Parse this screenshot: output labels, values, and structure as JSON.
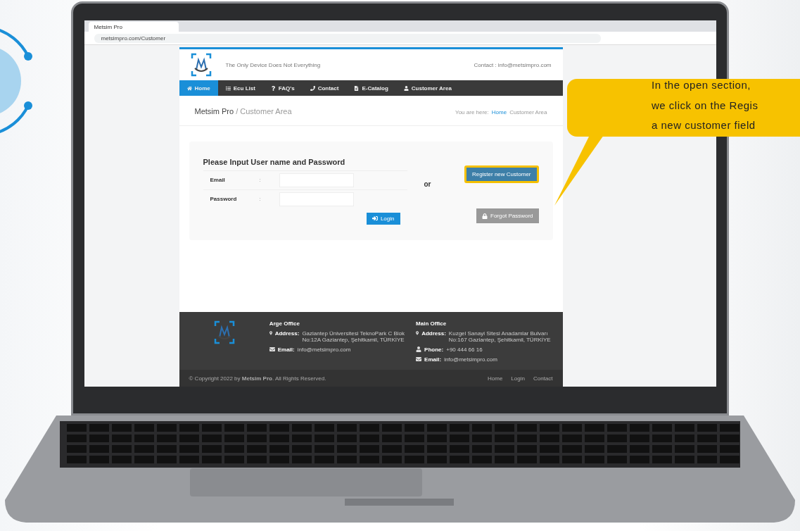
{
  "browser": {
    "tab_title": "Metsim Pro",
    "url": "metsimpro.com/Customer"
  },
  "site": {
    "tagline": "The Only Device Does Not Everything",
    "contact": "Contact : info@metsimpro.com",
    "nav": [
      {
        "label": "Home",
        "selected": true
      },
      {
        "label": "Ecu List",
        "selected": false
      },
      {
        "label": "FAQ's",
        "selected": false
      },
      {
        "label": "Contact",
        "selected": false
      },
      {
        "label": "E-Catalog",
        "selected": false
      },
      {
        "label": "Customer Area",
        "selected": false
      }
    ],
    "heading": {
      "brand": "Metsim Pro",
      "section": "/ Customer Area"
    },
    "breadcrumb": {
      "prefix": "You are here:",
      "home": "Home",
      "current": "Customer Area"
    },
    "login": {
      "title": "Please Input User name and Password",
      "fields": [
        {
          "label": "Email",
          "separator": ":"
        },
        {
          "label": "Password",
          "separator": ":"
        }
      ],
      "button": "Login"
    },
    "or_text": "or",
    "register": {
      "label": "Register new Customer",
      "highlighted": true
    },
    "forgot": {
      "label": "Forgot Password"
    },
    "footer": {
      "offices": [
        {
          "title": "Arge Office",
          "lines": [
            {
              "kind": "address",
              "label": "Address:",
              "value": "Gaziantep Üniversitesi TeknoPark C Blok No:12A Gaziantep, Şehitkamil, TÜRKİYE"
            },
            {
              "kind": "email",
              "label": "Email:",
              "value": "info@metsimpro.com"
            }
          ]
        },
        {
          "title": "Main Office",
          "lines": [
            {
              "kind": "address",
              "label": "Address:",
              "value": "Kuzgel Sanayi Sitesi Anadamlar Bulvarı No:167 Gaziantep, Şehitkamil, TÜRKİYE"
            },
            {
              "kind": "phone",
              "label": "Phone:",
              "value": "+90 444 66 16"
            },
            {
              "kind": "email",
              "label": "Email:",
              "value": "info@metsimpro.com"
            }
          ]
        }
      ],
      "copyright": "© Copyright 2022 by **Metsim Pro**. All Rights Reserved.",
      "links": [
        "Home",
        "Login",
        "Contact"
      ]
    }
  },
  "callout": {
    "lines": [
      "In the open section,",
      "we click on the Regis",
      "a new customer field"
    ]
  }
}
